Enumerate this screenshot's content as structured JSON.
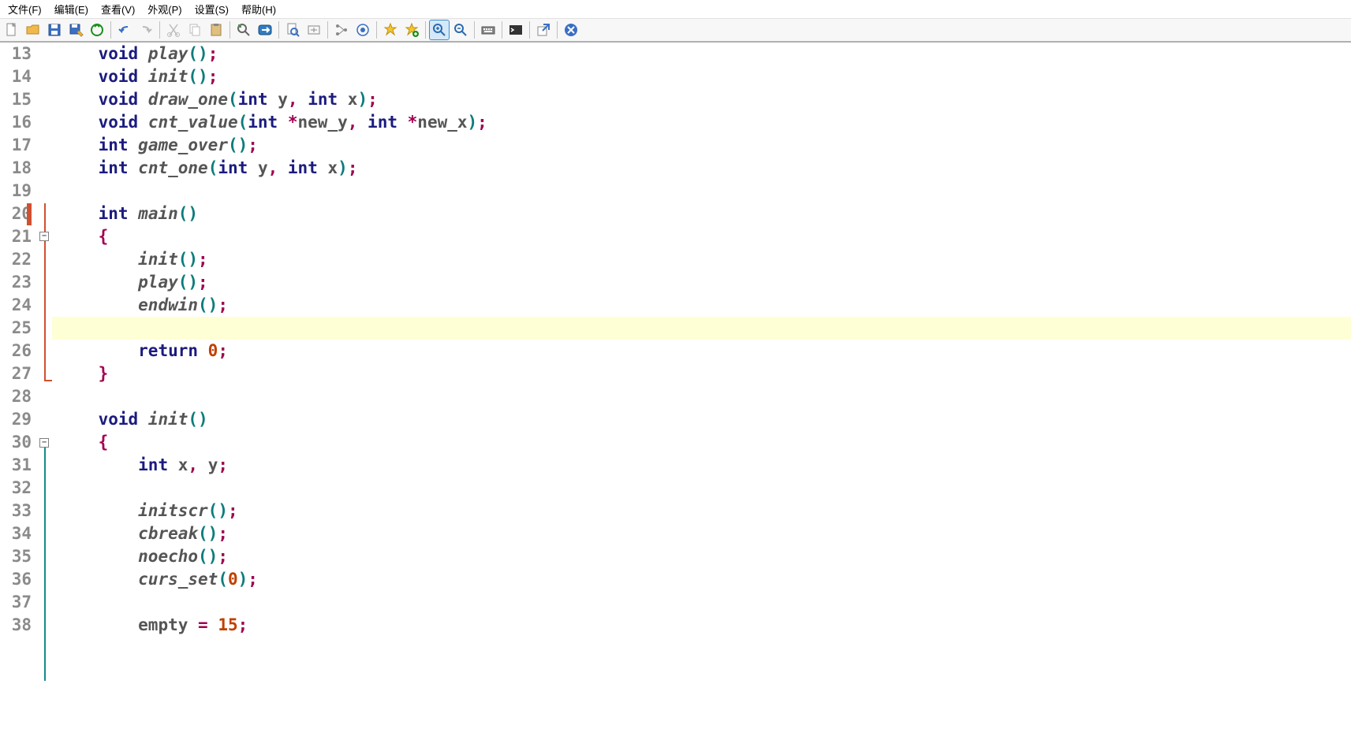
{
  "menu": {
    "file": "文件(F)",
    "edit": "编辑(E)",
    "view": "查看(V)",
    "appear": "外观(P)",
    "set": "设置(S)",
    "help": "帮助(H)"
  },
  "lines": {
    "n13": "13",
    "n14": "14",
    "n15": "15",
    "n16": "16",
    "n17": "17",
    "n18": "18",
    "n19": "19",
    "n20": "20",
    "n21": "21",
    "n22": "22",
    "n23": "23",
    "n24": "24",
    "n25": "25",
    "n26": "26",
    "n27": "27",
    "n28": "28",
    "n29": "29",
    "n30": "30",
    "n31": "31",
    "n32": "32",
    "n33": "33",
    "n34": "34",
    "n35": "35",
    "n36": "36",
    "n37": "37",
    "n38": "38"
  },
  "c": {
    "void": "void",
    "int": "int",
    "return": "return",
    "play": "play",
    "init": "init",
    "draw_one": "draw_one",
    "cnt_value": "cnt_value",
    "game_over": "game_over",
    "cnt_one": "cnt_one",
    "main": "main",
    "endwin": "endwin",
    "initscr": "initscr",
    "cbreak": "cbreak",
    "noecho": "noecho",
    "curs_set": "curs_set",
    "empty": "empty",
    "y": "y",
    "x": "x",
    "newy": "new_y",
    "newx": "new_x",
    "zero": "0",
    "fifteen": "15",
    "lp": "(",
    "rp": ")",
    "lb": "{",
    "rb": "}",
    "sc": ";",
    "cm": ",",
    "sp": " ",
    "st": "*",
    "eq": "="
  }
}
